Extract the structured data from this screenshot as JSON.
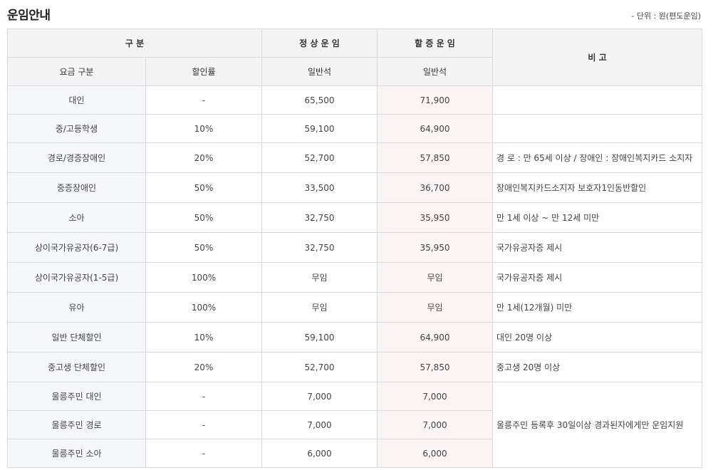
{
  "page": {
    "title": "운임안내",
    "unit_note": "- 단위 : 원(편도운임)"
  },
  "table": {
    "header": {
      "group": "구 분",
      "regular": "정 상 운 임",
      "surcharge": "할 증 운 임",
      "note": "비 고",
      "fare_type": "요금 구분",
      "discount_rate": "할인률",
      "regular_seat": "일반석",
      "surcharge_seat": "일반석"
    },
    "rows": [
      {
        "type": "대인",
        "rate": "-",
        "regular": "65,500",
        "surcharge": "71,900",
        "note": ""
      },
      {
        "type": "중/고등학생",
        "rate": "10%",
        "regular": "59,100",
        "surcharge": "64,900",
        "note": ""
      },
      {
        "type": "경로/경증장애인",
        "rate": "20%",
        "regular": "52,700",
        "surcharge": "57,850",
        "note": "경 로 : 만 65세 이상 / 장애인 : 장애인복지카드 소지자"
      },
      {
        "type": "중증장애인",
        "rate": "50%",
        "regular": "33,500",
        "surcharge": "36,700",
        "note": "장애인복지카드소지자 보호자1인동반할인"
      },
      {
        "type": "소아",
        "rate": "50%",
        "regular": "32,750",
        "surcharge": "35,950",
        "note": "만 1세 이상 ~ 만 12세 미만"
      },
      {
        "type": "상이국가유공자(6-7급)",
        "rate": "50%",
        "regular": "32,750",
        "surcharge": "35,950",
        "note": "국가유공자증 제시"
      },
      {
        "type": "상이국가유공자(1-5급)",
        "rate": "100%",
        "regular": "무임",
        "surcharge": "무임",
        "note": "국가유공자증 제시"
      },
      {
        "type": "유아",
        "rate": "100%",
        "regular": "무임",
        "surcharge": "무임",
        "note": "만 1세(12개월) 미만"
      },
      {
        "type": "일반 단체할인",
        "rate": "10%",
        "regular": "59,100",
        "surcharge": "64,900",
        "note": "대인 20명 이상"
      },
      {
        "type": "중고생 단체할인",
        "rate": "20%",
        "regular": "52,700",
        "surcharge": "57,850",
        "note": "중고생 20명 이상"
      },
      {
        "type": "울릉주민 대인",
        "rate": "-",
        "regular": "7,000",
        "surcharge": "7,000"
      },
      {
        "type": "울릉주민 경로",
        "rate": "-",
        "regular": "7,000",
        "surcharge": "7,000"
      },
      {
        "type": "울릉주민 소아",
        "rate": "-",
        "regular": "6,000",
        "surcharge": "6,000"
      }
    ],
    "resident_note": "울릉주민 등록후 30일이상 경과된자에게만 운임지원"
  }
}
